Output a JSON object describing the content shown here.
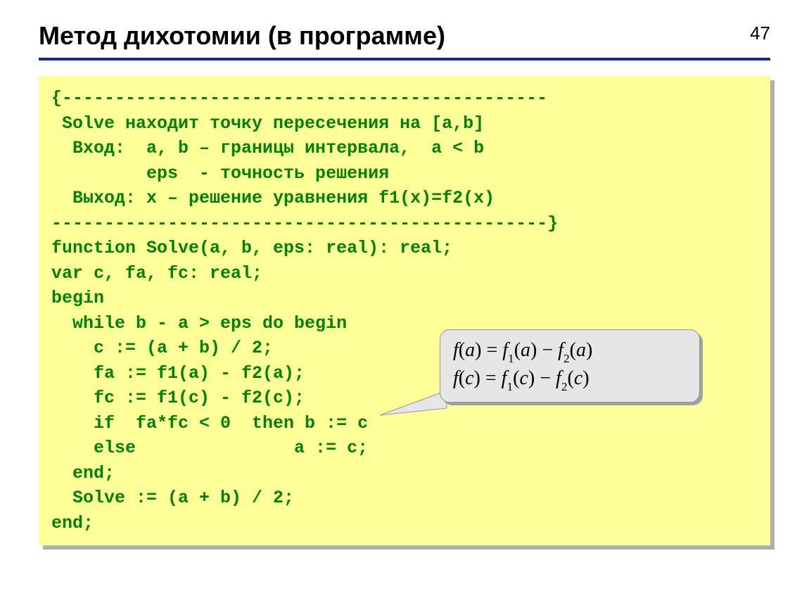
{
  "page_number": "47",
  "title": "Метод дихотомии (в программе)",
  "code": {
    "l1": "{----------------------------------------------",
    "l2": " Solve находит точку пересечения на [a,b]",
    "l3": "  Вход:  a, b – границы интервала,  a < b",
    "l4": "         eps  - точность решения",
    "l5": "  Выход: x – решение уравнения f1(x)=f2(x)",
    "l6": "-----------------------------------------------}",
    "l7": "function Solve(a, b, eps: real): real;",
    "l8": "var c, fa, fc: real;",
    "l9": "begin",
    "l10": "  while b - a > eps do begin",
    "l11": "    c := (a + b) / 2;",
    "l12": "    fa := f1(a) - f2(a);",
    "l13": "    fc := f1(c) - f2(c);",
    "l14": "    if  fa*fc < 0  then b := c",
    "l15": "    else               a := c;",
    "l16": "  end;",
    "l17": "  Solve := (a + b) / 2;",
    "l18": "end;"
  },
  "callout": {
    "line1_parts": [
      "f",
      "(",
      "a",
      ")",
      " = ",
      "f",
      "1",
      "(",
      "a",
      ")",
      " − ",
      "f",
      "2",
      "(",
      "a",
      ")"
    ],
    "line2_parts": [
      "f",
      "(",
      "c",
      ")",
      " = ",
      "f",
      "1",
      "(",
      "c",
      ")",
      " − ",
      "f",
      "2",
      "(",
      "c",
      ")"
    ]
  }
}
